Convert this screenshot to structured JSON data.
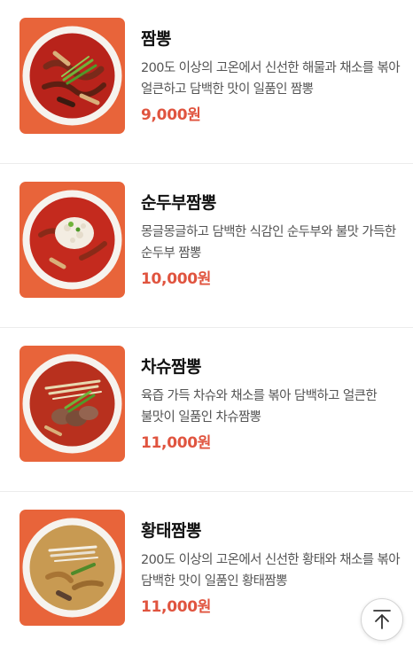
{
  "menu": {
    "items": [
      {
        "name": "짬뽕",
        "description": "200도 이상의 고온에서 신선한 해물과 채소를 볶아 얼큰하고 담백한 맛이 일품인 짬뽕",
        "price": "9,000원",
        "soup_color": "#b8231b",
        "topping_color": "#7a2a1a"
      },
      {
        "name": "순두부짬뽕",
        "description": "몽글몽글하고 담백한 식감인 순두부와 불맛 가득한 순두부 짬뽕",
        "price": "10,000원",
        "soup_color": "#c42a1e",
        "topping_color": "#f3ede2"
      },
      {
        "name": "차슈짬뽕",
        "description": "육즙 가득 차슈와 채소를 볶아 담백하고 얼큰한 불맛이 일품인 차슈짬뽕",
        "price": "11,000원",
        "soup_color": "#b8301e",
        "topping_color": "#8a5a44"
      },
      {
        "name": "황태짬뽕",
        "description": "200도 이상의 고온에서 신선한 황태와 채소를 볶아 담백한 맛이 일품인 황태짬뽕",
        "price": "11,000원",
        "soup_color": "#c89a52",
        "topping_color": "#e9e1d2"
      }
    ]
  },
  "colors": {
    "accent_price": "#e0543f",
    "thumbnail_background": "#e8643a"
  },
  "scroll_top_button": {
    "icon": "arrow-up-to-top-icon"
  }
}
